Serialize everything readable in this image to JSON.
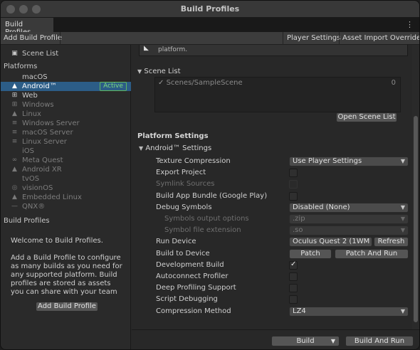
{
  "window": {
    "title": "Build Profiles"
  },
  "tabstrip": {
    "tab_label": "Build Profiles",
    "menu_glyph": "⋮"
  },
  "toolbar": {
    "add_build_profile": "Add Build Profile",
    "player_settings": "Player Settings",
    "asset_import_overrides": "Asset Import Overrides"
  },
  "sidebar": {
    "scene_list": {
      "label": "Scene List",
      "icon": "scene-list-icon"
    },
    "platforms_header": "Platforms",
    "platforms": [
      {
        "label": "macOS",
        "icon": "apple-icon",
        "glyph": "",
        "state": "enabled"
      },
      {
        "label": "Android™",
        "icon": "android-icon",
        "glyph": "▲",
        "state": "selected",
        "badge": "Active"
      },
      {
        "label": "Web",
        "icon": "web-icon",
        "glyph": "⊞",
        "state": "enabled"
      },
      {
        "label": "Windows",
        "icon": "windows-icon",
        "glyph": "⊞",
        "state": "disabled"
      },
      {
        "label": "Linux",
        "icon": "linux-icon",
        "glyph": "▲",
        "state": "disabled"
      },
      {
        "label": "Windows Server",
        "icon": "server-icon",
        "glyph": "≡",
        "state": "disabled"
      },
      {
        "label": "macOS Server",
        "icon": "server-icon",
        "glyph": "≡",
        "state": "disabled"
      },
      {
        "label": "Linux Server",
        "icon": "server-icon",
        "glyph": "≡",
        "state": "disabled"
      },
      {
        "label": "iOS",
        "icon": "apple-icon",
        "glyph": "",
        "state": "disabled"
      },
      {
        "label": "Meta Quest",
        "icon": "meta-icon",
        "glyph": "∞",
        "state": "disabled"
      },
      {
        "label": "Android XR",
        "icon": "android-icon",
        "glyph": "▲",
        "state": "disabled"
      },
      {
        "label": "tvOS",
        "icon": "apple-icon",
        "glyph": "",
        "state": "disabled"
      },
      {
        "label": "visionOS",
        "icon": "vision-icon",
        "glyph": "◎",
        "state": "disabled"
      },
      {
        "label": "Embedded Linux",
        "icon": "linux-icon",
        "glyph": "▲",
        "state": "disabled"
      },
      {
        "label": "QNX®",
        "icon": "qnx-icon",
        "glyph": "—",
        "state": "disabled"
      }
    ],
    "build_profiles_header": "Build Profiles",
    "welcome_title": "Welcome to Build Profiles.",
    "welcome_body": "Add a Build Profile to configure as many builds as you need for any supported platform. Build profiles are stored as assets you can share with your team",
    "add_button": "Add Build Profile"
  },
  "main": {
    "top_partial_text": "platform.",
    "scene_list_title": "Scene List",
    "scenes": [
      {
        "name": "Scenes/SampleScene",
        "index": "0",
        "enabled": true
      }
    ],
    "open_scene_list": "Open Scene List",
    "platform_settings_title": "Platform Settings",
    "android_settings_title": "Android™ Settings",
    "settings": [
      {
        "label": "Texture Compression",
        "type": "dropdown",
        "value": "Use Player Settings",
        "disabled": false
      },
      {
        "label": "Export Project",
        "type": "checkbox",
        "checked": false,
        "disabled": false
      },
      {
        "label": "Symlink Sources",
        "type": "checkbox",
        "checked": false,
        "disabled": true
      },
      {
        "label": "Build App Bundle (Google Play)",
        "type": "checkbox",
        "checked": false,
        "disabled": false
      },
      {
        "label": "Debug Symbols",
        "type": "dropdown",
        "value": "Disabled (None)",
        "disabled": false
      },
      {
        "label": "Symbols output options",
        "type": "dropdown",
        "value": ".zip",
        "disabled": true
      },
      {
        "label": "Symbol file extension",
        "type": "dropdown",
        "value": ".so",
        "disabled": true
      },
      {
        "label": "Run Device",
        "type": "device",
        "value": "Oculus Quest 2 (1WM",
        "button": "Refresh"
      },
      {
        "label": "Build to Device",
        "type": "buttons",
        "buttons": [
          "Patch",
          "Patch And Run"
        ]
      },
      {
        "label": "Development Build",
        "type": "checkbox",
        "checked": true,
        "disabled": false
      },
      {
        "label": "Autoconnect Profiler",
        "type": "checkbox",
        "checked": false,
        "disabled": false
      },
      {
        "label": "Deep Profiling Support",
        "type": "checkbox",
        "checked": false,
        "disabled": false
      },
      {
        "label": "Script Debugging",
        "type": "checkbox",
        "checked": false,
        "disabled": false
      },
      {
        "label": "Compression Method",
        "type": "dropdown",
        "value": "LZ4",
        "disabled": false
      }
    ]
  },
  "bottom": {
    "build": "Build",
    "build_and_run": "Build And Run"
  },
  "colors": {
    "selection": "#2c5d87",
    "active_badge": "#5fb85f",
    "background": "#282828"
  }
}
